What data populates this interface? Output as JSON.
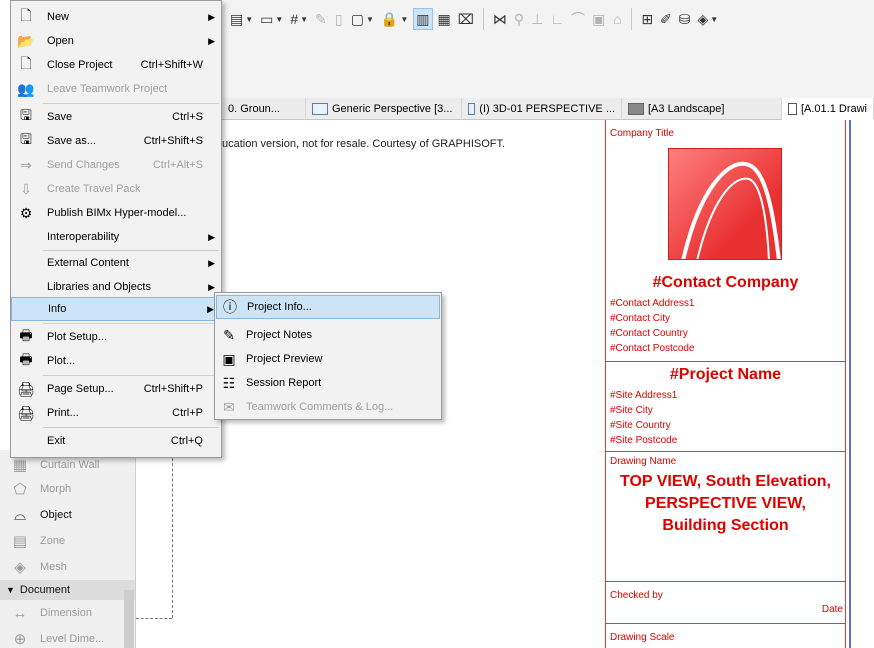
{
  "file_menu": {
    "items": [
      {
        "label": "New",
        "shortcut": "",
        "submenu": true,
        "disabled": false,
        "icon": "new-document-icon",
        "glyph": "🗋"
      },
      {
        "label": "Open",
        "shortcut": "",
        "submenu": true,
        "disabled": false,
        "icon": "open-folder-icon",
        "glyph": "📂"
      },
      {
        "label": "Close Project",
        "shortcut": "Ctrl+Shift+W",
        "submenu": false,
        "disabled": false,
        "icon": "close-project-icon",
        "glyph": "🗋"
      },
      {
        "label": "Leave Teamwork Project",
        "shortcut": "",
        "submenu": false,
        "disabled": true,
        "icon": "leave-teamwork-icon",
        "glyph": "👥"
      },
      {
        "label": "Save",
        "shortcut": "Ctrl+S",
        "submenu": false,
        "disabled": false,
        "icon": "save-icon",
        "glyph": "🖫"
      },
      {
        "label": "Save as...",
        "shortcut": "Ctrl+Shift+S",
        "submenu": false,
        "disabled": false,
        "icon": "save-as-icon",
        "glyph": "🖫"
      },
      {
        "label": "Send Changes",
        "shortcut": "Ctrl+Alt+S",
        "submenu": false,
        "disabled": true,
        "icon": "send-changes-icon",
        "glyph": "⇒"
      },
      {
        "label": "Create Travel Pack",
        "shortcut": "",
        "submenu": false,
        "disabled": true,
        "icon": "travel-pack-icon",
        "glyph": "⇩"
      },
      {
        "label": "Publish BIMx Hyper-model...",
        "shortcut": "",
        "submenu": false,
        "disabled": false,
        "icon": "bimx-icon",
        "glyph": "⚙"
      },
      {
        "label": "Interoperability",
        "shortcut": "",
        "submenu": true,
        "disabled": false,
        "icon": "",
        "glyph": ""
      },
      {
        "label": "External Content",
        "shortcut": "",
        "submenu": true,
        "disabled": false,
        "icon": "",
        "glyph": ""
      },
      {
        "label": "Libraries and Objects",
        "shortcut": "",
        "submenu": true,
        "disabled": false,
        "icon": "",
        "glyph": ""
      },
      {
        "label": "Info",
        "shortcut": "",
        "submenu": true,
        "disabled": false,
        "icon": "",
        "glyph": ""
      },
      {
        "label": "Plot Setup...",
        "shortcut": "",
        "submenu": false,
        "disabled": false,
        "icon": "plot-setup-icon",
        "glyph": "🖶"
      },
      {
        "label": "Plot...",
        "shortcut": "",
        "submenu": false,
        "disabled": false,
        "icon": "plot-icon",
        "glyph": "🖶"
      },
      {
        "label": "Page Setup...",
        "shortcut": "Ctrl+Shift+P",
        "submenu": false,
        "disabled": false,
        "icon": "page-setup-icon",
        "glyph": "🖨"
      },
      {
        "label": "Print...",
        "shortcut": "Ctrl+P",
        "submenu": false,
        "disabled": false,
        "icon": "print-icon",
        "glyph": "🖨"
      },
      {
        "label": "Exit",
        "shortcut": "Ctrl+Q",
        "submenu": false,
        "disabled": false,
        "icon": "",
        "glyph": ""
      }
    ]
  },
  "info_submenu": {
    "items": [
      {
        "label": "Project Info...",
        "disabled": false,
        "icon": "info-icon",
        "glyph": "ⓘ"
      },
      {
        "label": "Project Notes",
        "disabled": false,
        "icon": "notes-icon",
        "glyph": "✎"
      },
      {
        "label": "Project Preview",
        "disabled": false,
        "icon": "preview-icon",
        "glyph": "▣"
      },
      {
        "label": "Session Report",
        "disabled": false,
        "icon": "report-icon",
        "glyph": "☷"
      },
      {
        "label": "Teamwork Comments & Log...",
        "disabled": true,
        "icon": "teamwork-log-icon",
        "glyph": "✉"
      }
    ]
  },
  "tabs": [
    {
      "label": "0. Groun...",
      "active": false
    },
    {
      "label": "Generic Perspective [3...",
      "active": false
    },
    {
      "label": "(I) 3D-01 PERSPECTIVE ...",
      "active": false
    },
    {
      "label": "[A3 Landscape]",
      "active": false
    },
    {
      "label": "[A.01.1 Drawi",
      "active": true
    }
  ],
  "canvas": {
    "edu_note": "ucation version, not for resale. Courtesy of GRAPHISOFT."
  },
  "title_block": {
    "company_title": "Company Title",
    "contact_company": "#Contact Company",
    "contact_lines": [
      "#Contact Address1",
      "#Contact City",
      "#Contact Country",
      "#Contact Postcode"
    ],
    "project_name": "#Project Name",
    "site_lines": [
      "#Site Address1",
      "#Site City",
      "#Site Country",
      "#Site Postcode"
    ],
    "drawing_name_label": "Drawing Name",
    "drawing_name": "TOP VIEW, South Elevation, PERSPECTIVE VIEW, Building Section",
    "checked_by_label": "Checked by",
    "date_label": "Date",
    "drawing_scale_label": "Drawing Scale"
  },
  "toolbox": {
    "tools": [
      {
        "label": "Curtain Wall",
        "enabled": false,
        "icon": "curtain-wall-icon",
        "glyph": "▦"
      },
      {
        "label": "Morph",
        "enabled": false,
        "icon": "morph-icon",
        "glyph": "⬠"
      },
      {
        "label": "Object",
        "enabled": true,
        "icon": "object-icon",
        "glyph": "🪑"
      },
      {
        "label": "Zone",
        "enabled": false,
        "icon": "zone-icon",
        "glyph": "▤"
      },
      {
        "label": "Mesh",
        "enabled": false,
        "icon": "mesh-icon",
        "glyph": "◈"
      }
    ],
    "group_label": "Document",
    "doc_tools": [
      {
        "label": "Dimension",
        "icon": "dimension-icon",
        "glyph": "↔"
      },
      {
        "label": "Level Dime...",
        "icon": "level-dimension-icon",
        "glyph": "⊕"
      }
    ]
  },
  "colors": {
    "title_block_red": "#e00000",
    "menu_highlight": "#cde4f7"
  }
}
